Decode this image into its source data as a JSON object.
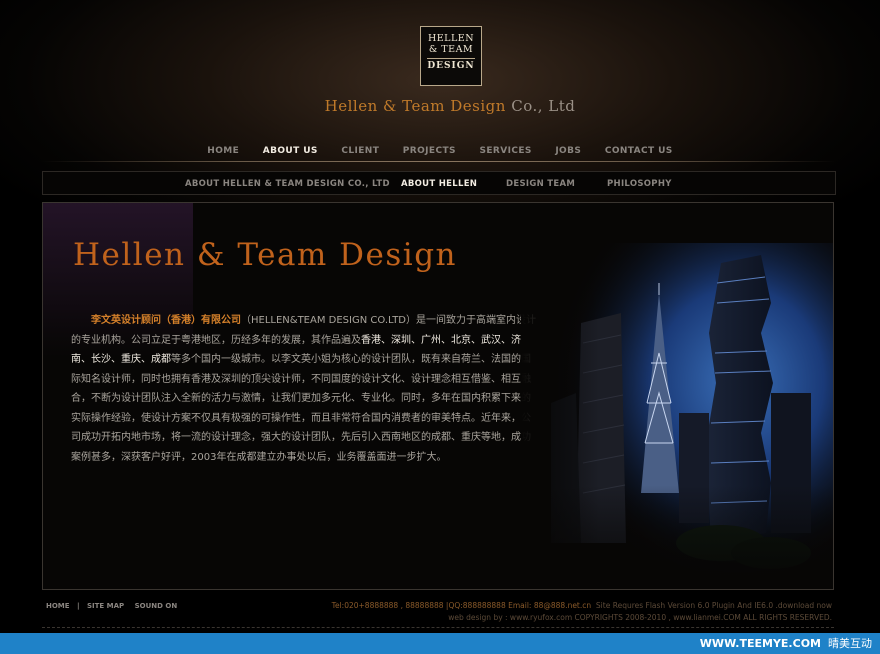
{
  "logo": {
    "line1": "HELLEN",
    "line2": "& TEAM",
    "line3": "DESIGN"
  },
  "brand": {
    "main": "Hellen & Team Design",
    "suffix": "Co., Ltd"
  },
  "main_nav": [
    {
      "label": "HOME",
      "active": false
    },
    {
      "label": "ABOUT US",
      "active": true
    },
    {
      "label": "CLIENT",
      "active": false
    },
    {
      "label": "PROJECTS",
      "active": false
    },
    {
      "label": "SERVICES",
      "active": false
    },
    {
      "label": "JOBS",
      "active": false
    },
    {
      "label": "CONTACT US",
      "active": false
    }
  ],
  "sub_nav": [
    {
      "label": "ABOUT HELLEN & TEAM DESIGN CO., LTD",
      "active": false
    },
    {
      "label": "ABOUT HELLEN",
      "active": true
    },
    {
      "label": "DESIGN TEAM",
      "active": false
    },
    {
      "label": "PHILOSOPHY",
      "active": false
    }
  ],
  "content": {
    "headline": "Hellen & Team Design",
    "company_name": "李文英设计顾问（香港）有限公司",
    "company_en": "（HELLEN&TEAM DESIGN CO.LTD）",
    "p1": "是一间致力于高端室内设计的专业机构。公司立足于粤港地区，历经多年的发展，其作品遍及",
    "cities": "香港、深圳、广州、北京、武汉、济南、长沙、重庆、成都",
    "p2": "等多个国内一级城市。以李文英小姐为核心的设计团队，既有来自荷兰、法国的国际知名设计师，同时也拥有香港及深圳的顶尖设计师，不同国度的设计文化、设计理念相互借鉴、相互融合，不断为设计团队注入全新的活力与激情，让我们更加多元化、专业化。同时，多年在国内积累下来的实际操作经验，使设计方案不仅具有极强的可操作性，而且非常符合国内消费者的审美特点。近年来，公司成功开拓内地市场，将一流的设计理念，强大的设计团队，先后引入西南地区的成都、重庆等地，成功案例甚多，深获客户好评，2003年在成都建立办事处以后，业务覆盖面进一步扩大。"
  },
  "footer": {
    "links": [
      "HOME",
      "SITE MAP",
      "SOUND ON"
    ],
    "separator": "|",
    "tel": "Tel:020+8888888 , 88888888 |QQ:888888888 Email: 88@888.net.cn",
    "flash": "Site Requres Flash Version 6.0 Plugin And IE6.0 .download now",
    "credit": "web design by : www.ryufox.com  COPYRIGHTS 2008-2010 , www.lianmei.COM ALL RIGHTS RESERVED."
  },
  "watermark": {
    "url": "WWW.TEEMYE.COM",
    "name": "晴美互动"
  },
  "colors": {
    "accent": "#c0621c",
    "active_nav": "#f2ece2",
    "inactive_nav": "#8a8580",
    "watermark_bar": "#1f82c8"
  }
}
